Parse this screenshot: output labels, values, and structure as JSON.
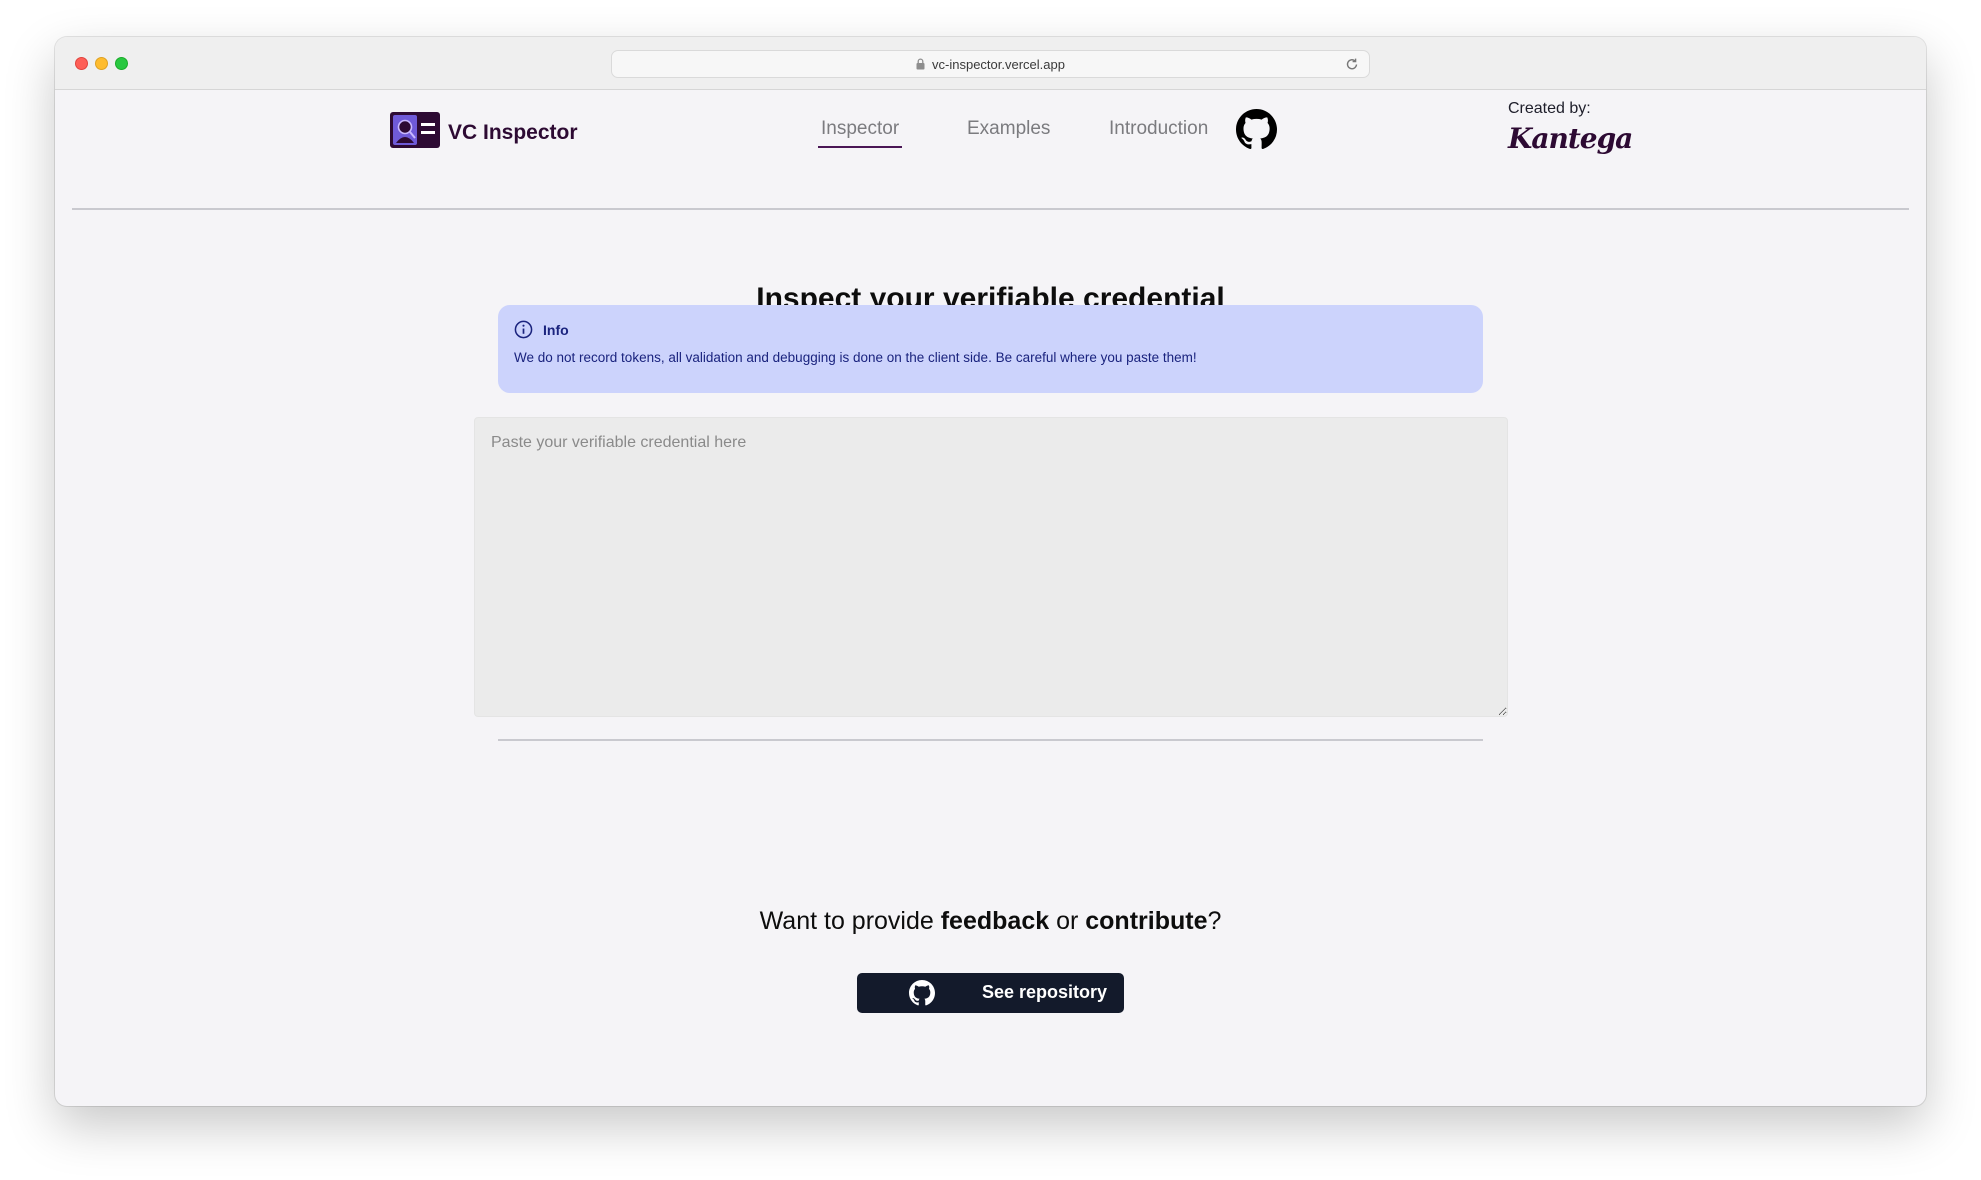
{
  "browser": {
    "url": "vc-inspector.vercel.app",
    "icons": [
      "lock-icon",
      "reload-icon"
    ]
  },
  "header": {
    "app_name": "VC Inspector",
    "nav": [
      {
        "label": "Inspector",
        "active": true
      },
      {
        "label": "Examples",
        "active": false
      },
      {
        "label": "Introduction",
        "active": false
      }
    ],
    "created_by_label": "Created by:",
    "created_by_name": "Kantega"
  },
  "main": {
    "title": "Inspect your verifiable credential",
    "info": {
      "heading": "Info",
      "text": "We do not record tokens, all validation and debugging is done on the client side. Be careful where you paste them!"
    },
    "credential_input": {
      "placeholder": "Paste your verifiable credential here",
      "value": ""
    }
  },
  "footer": {
    "cta_prefix": "Want to provide ",
    "cta_feedback": "feedback",
    "cta_or": " or ",
    "cta_contribute": "contribute",
    "cta_suffix": "?",
    "button_label": "See repository"
  },
  "colors": {
    "brand": "#2d0a33",
    "info_bg": "#ccd3fc",
    "info_text": "#1a237e",
    "button_bg": "#131a2b"
  }
}
